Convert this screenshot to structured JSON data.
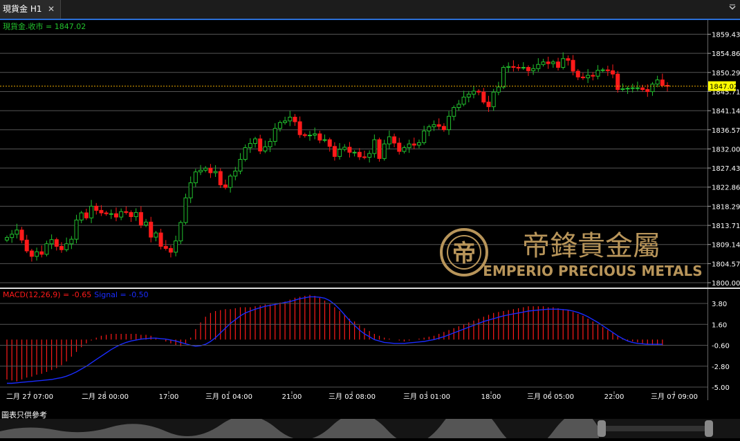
{
  "tab": {
    "title": "現貨金 H1",
    "close": "✕"
  },
  "menu_icon": "chevron-down-icon",
  "price_legend": "現貨金.收市 = 1847.02",
  "macd_legend": {
    "macd": "MACD(12,26,9) = -0.65",
    "signal": "Signal = -0.50"
  },
  "footer_note": "圖表只供參考",
  "watermark": {
    "chinese": "帝鋒貴金屬",
    "english": "EMPERIO PRECIOUS METALS"
  },
  "colors": {
    "bull": "#22c22e",
    "bear": "#ff1a1a",
    "signal": "#1a2cff",
    "grid": "#555555",
    "current_price": "#ffff00",
    "gold": "#b8955a"
  },
  "chart_data": [
    {
      "type": "candlestick",
      "title": "現貨金 H1",
      "ylabel": "",
      "y_ticks": [
        "1859.43",
        "1854.86",
        "1850.29",
        "1845.71",
        "1841.14",
        "1836.57",
        "1832.00",
        "1827.43",
        "1822.86",
        "1818.29",
        "1813.71",
        "1809.14",
        "1804.57",
        "1800.00"
      ],
      "ylim": [
        1800.0,
        1861.5
      ],
      "current_price": "1847.02",
      "x_ticks": [
        "二月 27 07:00",
        "二月 28 00:00",
        "17:00",
        "三月 01 04:00",
        "21:00",
        "三月 02 08:00",
        "三月 03 01:00",
        "18:00",
        "三月 06 05:00",
        "22:00",
        "三月 07 09:00"
      ],
      "close": [
        1810.8,
        1811.6,
        1812.6,
        1810.2,
        1807.6,
        1806.3,
        1807.4,
        1806.8,
        1809.3,
        1810.3,
        1808.7,
        1807.9,
        1809.3,
        1810.4,
        1815.0,
        1816.7,
        1815.5,
        1818.3,
        1817.3,
        1816.7,
        1816.5,
        1816.5,
        1815.7,
        1817.0,
        1816.8,
        1815.8,
        1816.8,
        1813.8,
        1814.5,
        1810.9,
        1811.9,
        1808.7,
        1808.2,
        1807.3,
        1810.0,
        1814.4,
        1820.3,
        1823.9,
        1826.5,
        1826.9,
        1827.4,
        1826.3,
        1826.6,
        1823.4,
        1822.8,
        1825.5,
        1826.7,
        1829.5,
        1832.3,
        1833.3,
        1834.4,
        1831.5,
        1832.5,
        1833.8,
        1836.9,
        1838.3,
        1838.7,
        1839.6,
        1838.5,
        1835.4,
        1835.2,
        1835.3,
        1835.6,
        1834.1,
        1834.2,
        1832.6,
        1830.2,
        1831.9,
        1832.4,
        1831.2,
        1831.2,
        1830.1,
        1830.0,
        1830.9,
        1834.2,
        1829.7,
        1833.2,
        1834.9,
        1833.4,
        1831.4,
        1832.3,
        1833.2,
        1832.9,
        1833.5,
        1836.3,
        1837.3,
        1837.8,
        1837.4,
        1836.6,
        1839.8,
        1841.9,
        1842.7,
        1844.4,
        1845.1,
        1845.8,
        1845.6,
        1843.2,
        1842.1,
        1845.6,
        1846.8,
        1851.5,
        1851.7,
        1851.5,
        1851.4,
        1851.5,
        1850.7,
        1851.2,
        1852.2,
        1852.8,
        1852.4,
        1852.8,
        1851.5,
        1853.6,
        1853.2,
        1850.6,
        1849.2,
        1849.0,
        1849.6,
        1849.4,
        1850.8,
        1850.9,
        1850.7,
        1849.9,
        1846.2,
        1846.4,
        1846.5,
        1846.6,
        1846.6,
        1846.2,
        1845.7,
        1847.5,
        1848.5,
        1847.2,
        1847.0
      ],
      "macd": [
        -4.2,
        -4.3,
        -4.4,
        -4.2,
        -4.0,
        -3.9,
        -3.7,
        -3.6,
        -3.4,
        -3.2,
        -3.0,
        -2.7,
        -2.3,
        -1.8,
        -1.3,
        -0.8,
        -0.4,
        -0.1,
        0.2,
        0.4,
        0.5,
        0.6,
        0.6,
        0.6,
        0.6,
        0.6,
        0.6,
        0.5,
        0.5,
        0.4,
        0.2,
        0.0,
        -0.2,
        -0.4,
        -0.6,
        -0.7,
        -0.4,
        0.2,
        1.1,
        1.8,
        2.4,
        2.8,
        3.0,
        3.1,
        3.2,
        3.2,
        3.3,
        3.4,
        3.4,
        3.4,
        3.5,
        3.6,
        3.7,
        3.7,
        3.8,
        3.9,
        4.0,
        4.2,
        4.4,
        4.5,
        4.6,
        4.7,
        4.6,
        4.4,
        4.1,
        3.8,
        3.4,
        3.0,
        2.6,
        2.2,
        1.9,
        1.5,
        1.2,
        0.9,
        0.6,
        0.4,
        0.2,
        0.1,
        0.0,
        -0.1,
        -0.2,
        -0.1,
        0.0,
        0.1,
        0.2,
        0.3,
        0.4,
        0.6,
        0.8,
        1.0,
        1.2,
        1.4,
        1.6,
        1.8,
        2.0,
        2.2,
        2.4,
        2.6,
        2.8,
        2.9,
        3.0,
        3.1,
        3.2,
        3.3,
        3.4,
        3.5,
        3.5,
        3.5,
        3.5,
        3.4,
        3.4,
        3.3,
        3.2,
        3.1,
        2.9,
        2.7,
        2.5,
        2.2,
        1.9,
        1.6,
        1.3,
        1.0,
        0.7,
        0.4,
        0.1,
        -0.1,
        -0.2,
        -0.3,
        -0.4,
        -0.5,
        -0.6,
        -0.6,
        -0.65
      ],
      "signal": [
        -4.6,
        -4.6,
        -4.55,
        -4.5,
        -4.45,
        -4.4,
        -4.35,
        -4.3,
        -4.25,
        -4.2,
        -4.1,
        -4.0,
        -3.85,
        -3.65,
        -3.4,
        -3.1,
        -2.8,
        -2.45,
        -2.1,
        -1.75,
        -1.4,
        -1.05,
        -0.75,
        -0.5,
        -0.3,
        -0.15,
        -0.05,
        0.05,
        0.1,
        0.15,
        0.15,
        0.1,
        0.05,
        -0.05,
        -0.15,
        -0.3,
        -0.45,
        -0.6,
        -0.7,
        -0.65,
        -0.5,
        -0.2,
        0.2,
        0.7,
        1.2,
        1.7,
        2.1,
        2.5,
        2.8,
        3.0,
        3.2,
        3.35,
        3.5,
        3.6,
        3.7,
        3.8,
        3.9,
        4.0,
        4.15,
        4.3,
        4.4,
        4.5,
        4.5,
        4.45,
        4.35,
        4.1,
        3.7,
        3.2,
        2.6,
        2.0,
        1.5,
        1.0,
        0.6,
        0.3,
        0.0,
        -0.15,
        -0.3,
        -0.35,
        -0.4,
        -0.4,
        -0.4,
        -0.35,
        -0.3,
        -0.25,
        -0.2,
        -0.1,
        0.0,
        0.15,
        0.3,
        0.5,
        0.7,
        0.9,
        1.1,
        1.3,
        1.5,
        1.7,
        1.9,
        2.05,
        2.2,
        2.35,
        2.5,
        2.6,
        2.7,
        2.8,
        2.9,
        3.0,
        3.05,
        3.1,
        3.15,
        3.2,
        3.2,
        3.2,
        3.15,
        3.1,
        3.0,
        2.85,
        2.65,
        2.4,
        2.1,
        1.8,
        1.45,
        1.1,
        0.75,
        0.4,
        0.1,
        -0.15,
        -0.3,
        -0.4,
        -0.45,
        -0.5,
        -0.5,
        -0.5,
        -0.5
      ],
      "macd_ticks": [
        "3.80",
        "1.60",
        "-0.60",
        "-2.80",
        "-5.00"
      ]
    }
  ]
}
